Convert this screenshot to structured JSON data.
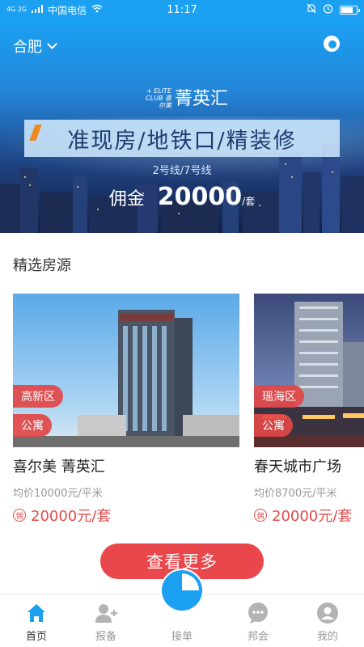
{
  "statusbar": {
    "carrier": "中国电信",
    "network": "4G 2G",
    "time": "11:17"
  },
  "banner": {
    "city": "合肥",
    "logo_small": "+ ELITE CLUB 喜尔美",
    "logo_name": "菁英汇",
    "slogan": "准现房/地铁口/精装修",
    "metro_lines": "2号线/7号线",
    "commission_label": "佣金",
    "commission_amount": "20000",
    "commission_unit": "/套"
  },
  "section": {
    "title": "精选房源"
  },
  "listings": [
    {
      "district": "高新区",
      "type": "公寓",
      "name": "喜尔美 菁英汇",
      "avg_price": "均价10000元/平米",
      "commission_icon": "佣",
      "commission": "20000元/套"
    },
    {
      "district": "瑶海区",
      "type": "公寓",
      "name": "春天城市广场",
      "avg_price": "均价8700元/平米",
      "commission_icon": "佣",
      "commission": "20000元/套"
    }
  ],
  "more_button": "查看更多",
  "nav": {
    "items": [
      {
        "label": "首页",
        "icon": "home-icon"
      },
      {
        "label": "报备",
        "icon": "add-user-icon"
      },
      {
        "label": "接单",
        "icon": "accept-order-icon"
      },
      {
        "label": "邦会",
        "icon": "chat-icon"
      },
      {
        "label": "我的",
        "icon": "profile-icon"
      }
    ]
  },
  "colors": {
    "statusbar": "#1ba0f2",
    "accent_red": "#e9474c",
    "nav_blue": "#1ba0f2"
  }
}
